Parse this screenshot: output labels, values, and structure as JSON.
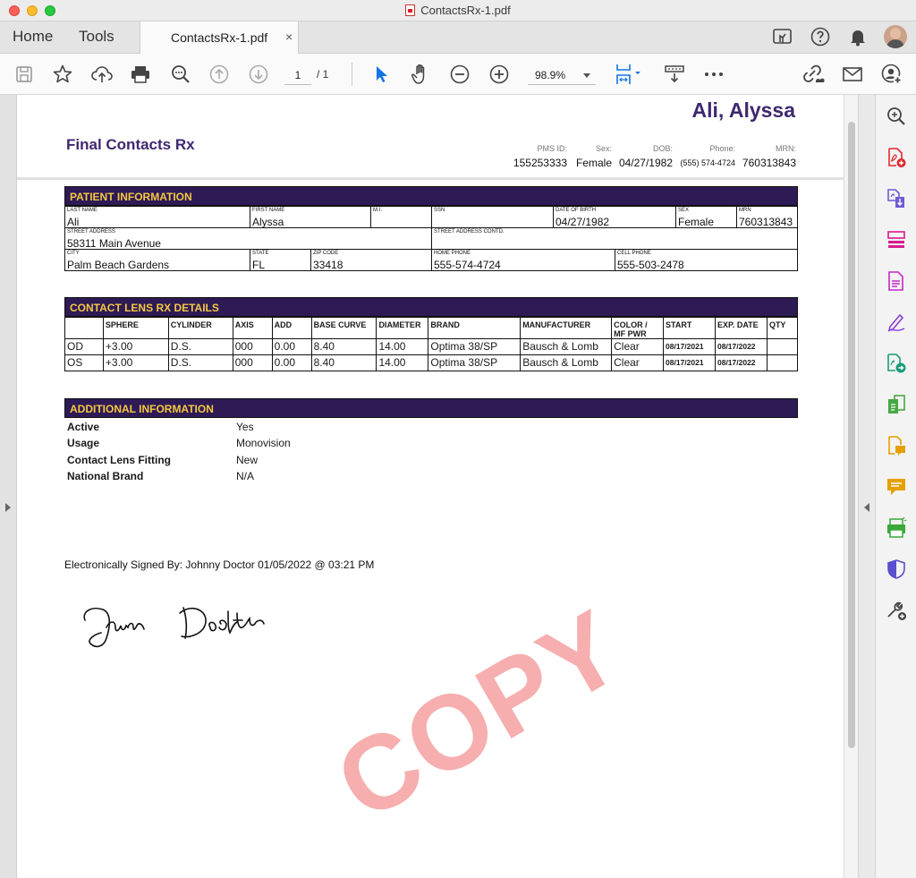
{
  "window": {
    "title": "ContactsRx-1.pdf"
  },
  "tabs": {
    "home": "Home",
    "tools": "Tools",
    "document_tab": "ContactsRx-1.pdf",
    "close_glyph": "×"
  },
  "toolbar": {
    "current_page": "1",
    "total_pages": "/ 1",
    "zoom": "98.9%"
  },
  "document": {
    "patient_name": "Ali, Alyssa",
    "title": "Final Contacts Rx",
    "header": {
      "pms_label": "PMS ID:",
      "pms_value": "155253333",
      "sex_label": "Sex:",
      "sex_value": "Female",
      "dob_label": "DOB:",
      "dob_value": "04/27/1982",
      "phone_label": "Phone:",
      "phone_value": "(555) 574-4724",
      "mrn_label": "MRN:",
      "mrn_value": "760313843"
    },
    "patient_info": {
      "heading": "PATIENT INFORMATION",
      "last_name_label": "LAST NAME",
      "last_name": "Ali",
      "first_name_label": "FIRST NAME",
      "first_name": "Alyssa",
      "mi_label": "M.I.",
      "mi": "",
      "ssn_label": "SSN",
      "ssn": "",
      "dob_label": "DATE OF BIRTH",
      "dob": "04/27/1982",
      "sex_label": "SEX",
      "sex": "Female",
      "mrn_label": "MRN",
      "mrn": "760313843",
      "street_label": "STREET ADDRESS",
      "street": "58311 Main Avenue",
      "street2_label": "STREET ADDRESS CONTD.",
      "street2": "",
      "city_label": "CITY",
      "city": "Palm Beach Gardens",
      "state_label": "STATE",
      "state": "FL",
      "zip_label": "ZIP CODE",
      "zip": "33418",
      "home_phone_label": "HOME PHONE",
      "home_phone": "555-574-4724",
      "cell_phone_label": "CELL PHONE",
      "cell_phone": "555-503-2478"
    },
    "rx": {
      "heading": "CONTACT LENS RX DETAILS",
      "columns": [
        "",
        "SPHERE",
        "CYLINDER",
        "AXIS",
        "ADD",
        "BASE CURVE",
        "DIAMETER",
        "BRAND",
        "MANUFACTURER",
        "COLOR / MF PWR",
        "START",
        "EXP. DATE",
        "QTY"
      ],
      "rows": [
        [
          "OD",
          "+3.00",
          "D.S.",
          "000",
          "0.00",
          "8.40",
          "14.00",
          "Optima 38/SP",
          "Bausch & Lomb",
          "Clear",
          "08/17/2021",
          "08/17/2022",
          ""
        ],
        [
          "OS",
          "+3.00",
          "D.S.",
          "000",
          "0.00",
          "8.40",
          "14.00",
          "Optima 38/SP",
          "Bausch & Lomb",
          "Clear",
          "08/17/2021",
          "08/17/2022",
          ""
        ]
      ]
    },
    "additional": {
      "heading": "ADDITIONAL INFORMATION",
      "items": [
        {
          "key": "Active",
          "value": "Yes"
        },
        {
          "key": "Usage",
          "value": "Monovision"
        },
        {
          "key": "Contact Lens Fitting",
          "value": "New"
        },
        {
          "key": "National Brand",
          "value": "N/A"
        }
      ]
    },
    "signed_by": "Electronically Signed By: Johnny Doctor 01/05/2022 @ 03:21 PM",
    "signature_text": "Johnny Doctor",
    "watermark": "COPY"
  },
  "icons": {
    "toolbar": [
      "save-icon",
      "bookmark-star-icon",
      "upload-cloud-icon",
      "print-icon",
      "search-zoom-icon",
      "page-up-icon",
      "page-down-icon",
      "select-cursor-icon",
      "hand-icon",
      "zoom-out-icon",
      "zoom-in-icon",
      "fit-page-icon",
      "scroll-mode-icon",
      "more-icon",
      "share-link-icon",
      "email-icon",
      "add-user-icon"
    ],
    "rail": [
      "search-zoom-icon",
      "create-pdf-icon",
      "export-pdf-icon",
      "organize-pages-icon",
      "edit-pdf-icon",
      "fill-sign-icon",
      "send-review-icon",
      "compare-icon",
      "comment-doc-icon",
      "comment-icon",
      "scan-icon",
      "protect-icon",
      "more-tools-icon"
    ]
  },
  "colors": {
    "brand_purple": "#3f2770",
    "section_bar": "#2e1a55",
    "section_text": "#f4c842",
    "watermark": "#f07878",
    "accent_blue": "#1473e6"
  }
}
